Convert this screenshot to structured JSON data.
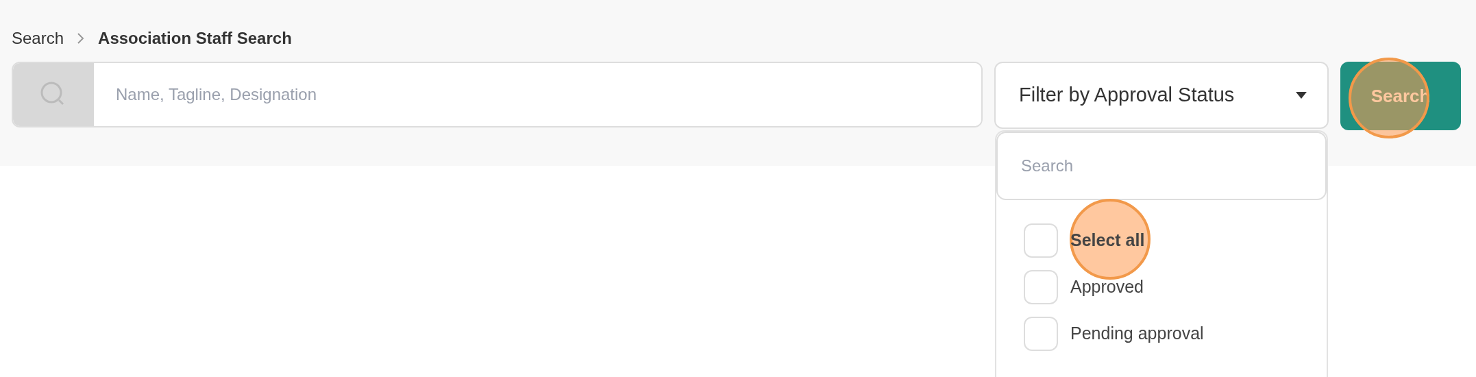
{
  "breadcrumb": [
    {
      "label": "Search",
      "current": false
    },
    {
      "label": "Association Staff Search",
      "current": true
    }
  ],
  "search": {
    "placeholder": "Name, Tagline, Designation"
  },
  "filter": {
    "label": "Filter by Approval Status",
    "expanded": true,
    "dropdown": {
      "search_placeholder": "Search",
      "options": [
        {
          "label": "Select all",
          "kind": "select_all",
          "checked": false,
          "highlighted": true
        },
        {
          "label": "Approved",
          "kind": "option",
          "checked": false,
          "highlighted": false
        },
        {
          "label": "Pending approval",
          "kind": "option",
          "checked": false,
          "highlighted": false
        }
      ]
    }
  },
  "search_button": {
    "label": "Search",
    "highlighted": true
  }
}
